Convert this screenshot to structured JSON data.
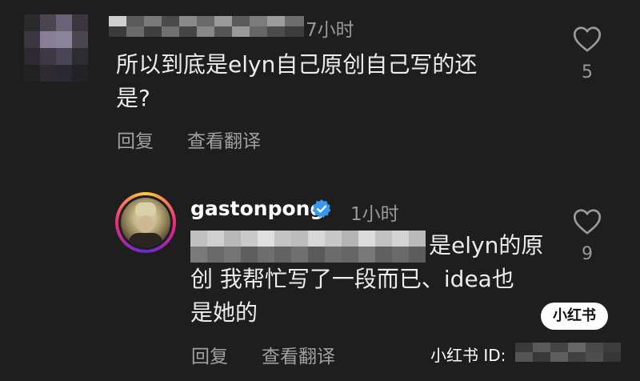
{
  "comments": [
    {
      "username": "",
      "time": "7小时",
      "text_line1": "所以到底是elyn自己原创自己写的还",
      "text_line2": "是?",
      "reply_label": "回复",
      "translate_label": "查看翻译",
      "likes": "5"
    },
    {
      "username": "gastonpong",
      "verified": true,
      "time": "1小时",
      "text_line1": "是elyn的原",
      "text_line2": "创 我帮忙写了一段而已、idea也",
      "text_line3": "是她的",
      "reply_label": "回复",
      "translate_label": "查看翻译",
      "likes": "9"
    }
  ],
  "watermark": {
    "logo_text": "小红书",
    "id_label": "小红书 ID:"
  },
  "colors": {
    "background": "#1e1e1e",
    "verified_badge": "#3897f0",
    "muted_text": "#9a9a9a"
  },
  "icons": [
    "heart-outline-icon",
    "verified-badge-icon"
  ]
}
